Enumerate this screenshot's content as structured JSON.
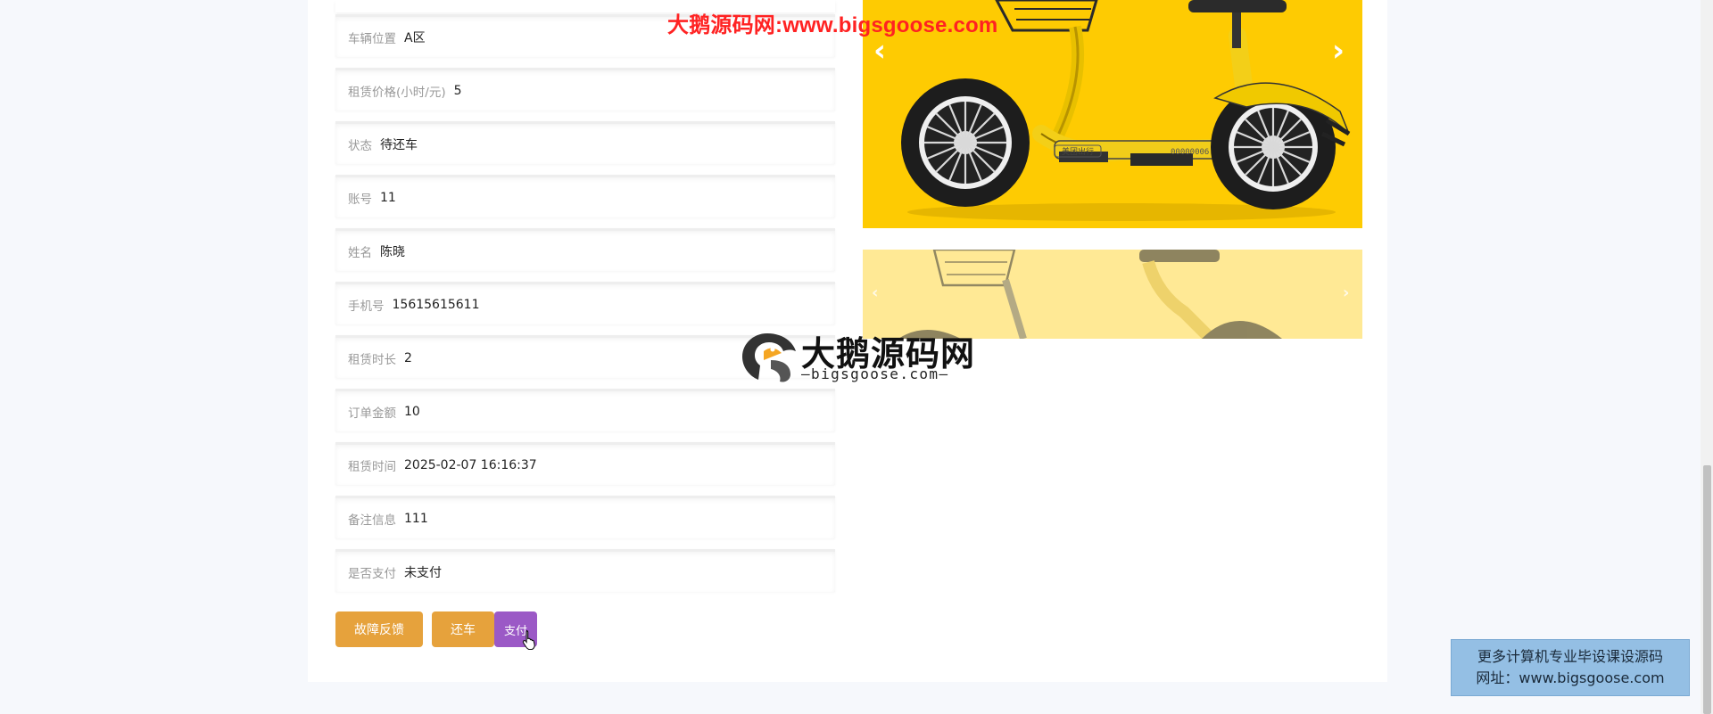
{
  "fields": [
    {
      "label": "车辆位置",
      "value": "A区"
    },
    {
      "label": "租赁价格(小时/元)",
      "value": "5"
    },
    {
      "label": "状态",
      "value": "待还车"
    },
    {
      "label": "账号",
      "value": "11"
    },
    {
      "label": "姓名",
      "value": "陈晓"
    },
    {
      "label": "手机号",
      "value": "15615615611"
    },
    {
      "label": "租赁时长",
      "value": "2"
    },
    {
      "label": "订单金额",
      "value": "10"
    },
    {
      "label": "租赁时间",
      "value": "2025-02-07 16:16:37"
    },
    {
      "label": "备注信息",
      "value": "111"
    },
    {
      "label": "是否支付",
      "value": "未支付"
    }
  ],
  "buttons": {
    "fault": "故障反馈",
    "return": "还车",
    "pay": "支付"
  },
  "carousel": {
    "prev_icon": "chevron-left-icon",
    "next_icon": "chevron-right-icon",
    "scooter_plate": "00000006",
    "scooter_badge": "美团出行"
  },
  "watermark": {
    "top_text": "大鹅源码网:www.bigsgoose.com",
    "logo_title": "大鹅源码网",
    "logo_sub": "—bigsgoose.com—"
  },
  "promo": {
    "line1": "更多计算机专业毕设课设源码",
    "line2": "网址：www.bigsgoose.com"
  },
  "colors": {
    "accent_orange": "#e6a23c",
    "accent_purple": "#9b59c6",
    "carousel_yellow": "#fecb02"
  }
}
